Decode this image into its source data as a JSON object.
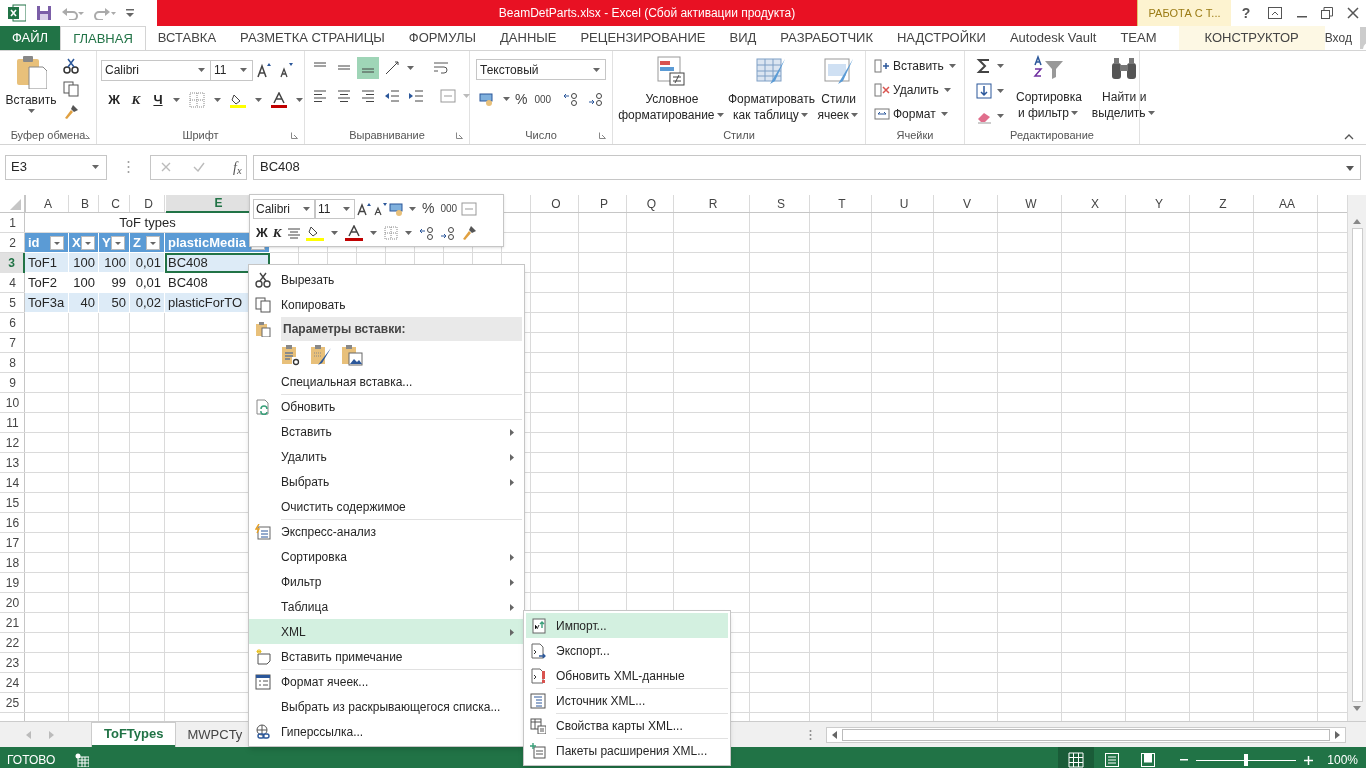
{
  "title_bar": {
    "title": "BeamDetParts.xlsx -  Excel (Сбой активации продукта)",
    "context_group": "РАБОТА С Т...",
    "help": "?"
  },
  "ribbon_tabs": [
    {
      "label": "ФАЙЛ",
      "kind": "file",
      "selected": false
    },
    {
      "label": "ГЛАВНАЯ",
      "kind": "tab",
      "selected": true
    },
    {
      "label": "ВСТАВКА",
      "kind": "tab",
      "selected": false
    },
    {
      "label": "РАЗМЕТКА СТРАНИЦЫ",
      "kind": "tab",
      "selected": false
    },
    {
      "label": "ФОРМУЛЫ",
      "kind": "tab",
      "selected": false
    },
    {
      "label": "ДАННЫЕ",
      "kind": "tab",
      "selected": false
    },
    {
      "label": "РЕЦЕНЗИРОВАНИЕ",
      "kind": "tab",
      "selected": false
    },
    {
      "label": "ВИД",
      "kind": "tab",
      "selected": false
    },
    {
      "label": "РАЗРАБОТЧИК",
      "kind": "tab",
      "selected": false
    },
    {
      "label": "НАДСТРОЙКИ",
      "kind": "tab",
      "selected": false
    },
    {
      "label": "Autodesk Vault",
      "kind": "tab",
      "selected": false
    },
    {
      "label": "TEAM",
      "kind": "tab",
      "selected": false
    },
    {
      "label": "КОНСТРУКТОР",
      "kind": "contextual",
      "selected": false
    }
  ],
  "account": {
    "label": "Вход"
  },
  "ribbon": {
    "clipboard": {
      "paste": "Вставить",
      "label": "Буфер обмена"
    },
    "font": {
      "name": "Calibri",
      "size": "11",
      "bold": "Ж",
      "italic": "К",
      "underline": "Ч",
      "label": "Шрифт"
    },
    "alignment": {
      "label": "Выравнивание",
      "vertical_align": [
        {
          "selected": false
        },
        {
          "selected": false
        },
        {
          "selected": true
        }
      ]
    },
    "number": {
      "format": "Текстовый",
      "percent": "%",
      "thousands": "000",
      "label": "Число"
    },
    "styles": {
      "buttons": [
        [
          "Условное",
          "форматирование"
        ],
        [
          "Форматировать",
          "как таблицу"
        ],
        [
          "Стили",
          "ячеек"
        ]
      ],
      "label": "Стили"
    },
    "cells": {
      "buttons": [
        "Вставить",
        "Удалить",
        "Формат"
      ],
      "label": "Ячейки"
    },
    "editing": {
      "buttons": [
        [
          "Сортировка",
          "и фильтр"
        ],
        [
          "Найти и",
          "выделить"
        ]
      ],
      "label": "Редактирование"
    }
  },
  "formula_bar": {
    "name_box": "E3",
    "fx": "f$_{x}$",
    "value": "BC408"
  },
  "sheet": {
    "columns": [
      {
        "label": "A",
        "selected": false
      },
      {
        "label": "B",
        "selected": false
      },
      {
        "label": "C",
        "selected": false
      },
      {
        "label": "D",
        "selected": false
      },
      {
        "label": "E",
        "selected": true
      },
      {
        "label": "O",
        "selected": false
      },
      {
        "label": "P",
        "selected": false
      },
      {
        "label": "Q",
        "selected": false
      },
      {
        "label": "R",
        "selected": false
      },
      {
        "label": "S",
        "selected": false
      },
      {
        "label": "T",
        "selected": false
      },
      {
        "label": "U",
        "selected": false
      },
      {
        "label": "V",
        "selected": false
      },
      {
        "label": "W",
        "selected": false
      },
      {
        "label": "X",
        "selected": false
      },
      {
        "label": "Y",
        "selected": false
      },
      {
        "label": "Z",
        "selected": false
      },
      {
        "label": "AA",
        "selected": false
      }
    ],
    "rows": [
      {
        "number": "1",
        "selected": false,
        "kind": "title",
        "cells": [
          {
            "text": "ToF types",
            "selected": false
          }
        ]
      },
      {
        "number": "2",
        "selected": false,
        "kind": "header",
        "cells": [
          {
            "text": "id",
            "selected": false
          },
          {
            "text": "X",
            "selected": false
          },
          {
            "text": "Y",
            "selected": false
          },
          {
            "text": "Z",
            "selected": false
          },
          {
            "text": "plasticMedia",
            "selected": false
          }
        ]
      },
      {
        "number": "3",
        "selected": true,
        "kind": "band",
        "cells": [
          {
            "text": "ToF1",
            "numeric": false,
            "selected": false
          },
          {
            "text": "100",
            "numeric": true,
            "selected": false
          },
          {
            "text": "100",
            "numeric": true,
            "selected": false
          },
          {
            "text": "0,01",
            "numeric": true,
            "selected": false
          },
          {
            "text": "BC408",
            "numeric": false,
            "selected": true
          }
        ]
      },
      {
        "number": "4",
        "selected": false,
        "kind": "plain",
        "cells": [
          {
            "text": "ToF2",
            "numeric": false,
            "selected": false
          },
          {
            "text": "100",
            "numeric": true,
            "selected": false
          },
          {
            "text": "99",
            "numeric": true,
            "selected": false
          },
          {
            "text": "0,01",
            "numeric": true,
            "selected": false
          },
          {
            "text": "BC408",
            "numeric": false,
            "selected": false
          }
        ]
      },
      {
        "number": "5",
        "selected": false,
        "kind": "band",
        "cells": [
          {
            "text": "ToF3a",
            "numeric": false,
            "selected": false
          },
          {
            "text": "40",
            "numeric": true,
            "selected": false
          },
          {
            "text": "50",
            "numeric": true,
            "selected": false
          },
          {
            "text": "0,02",
            "numeric": true,
            "selected": false
          },
          {
            "text": "plasticForTO",
            "numeric": false,
            "selected": false
          }
        ]
      },
      {
        "number": "6",
        "selected": false,
        "kind": "empty"
      },
      {
        "number": "7",
        "selected": false,
        "kind": "empty"
      },
      {
        "number": "8",
        "selected": false,
        "kind": "empty"
      },
      {
        "number": "9",
        "selected": false,
        "kind": "empty"
      },
      {
        "number": "10",
        "selected": false,
        "kind": "empty"
      },
      {
        "number": "11",
        "selected": false,
        "kind": "empty"
      },
      {
        "number": "12",
        "selected": false,
        "kind": "empty"
      },
      {
        "number": "13",
        "selected": false,
        "kind": "empty"
      },
      {
        "number": "14",
        "selected": false,
        "kind": "empty"
      },
      {
        "number": "15",
        "selected": false,
        "kind": "empty"
      },
      {
        "number": "16",
        "selected": false,
        "kind": "empty"
      },
      {
        "number": "17",
        "selected": false,
        "kind": "empty"
      },
      {
        "number": "18",
        "selected": false,
        "kind": "empty"
      },
      {
        "number": "19",
        "selected": false,
        "kind": "empty"
      },
      {
        "number": "20",
        "selected": false,
        "kind": "empty"
      },
      {
        "number": "21",
        "selected": false,
        "kind": "empty"
      },
      {
        "number": "22",
        "selected": false,
        "kind": "empty"
      },
      {
        "number": "23",
        "selected": false,
        "kind": "empty"
      },
      {
        "number": "24",
        "selected": false,
        "kind": "empty"
      },
      {
        "number": "25",
        "selected": false,
        "kind": "empty"
      }
    ]
  },
  "mini_toolbar": {
    "font": "Calibri",
    "size": "11",
    "percent": "%",
    "thousands": "000",
    "bold": "Ж",
    "italic": "К"
  },
  "context_menu": {
    "items": [
      {
        "kind": "item",
        "label": "Вырезать",
        "submenu": false,
        "selected": false,
        "separator_before": false
      },
      {
        "kind": "item",
        "label": "Копировать",
        "submenu": false,
        "selected": false,
        "separator_before": false
      },
      {
        "kind": "header",
        "label": "Параметры вставки:"
      },
      {
        "kind": "paste_options"
      },
      {
        "kind": "item",
        "label": "Специальная вставка...",
        "submenu": false,
        "selected": false,
        "separator_before": false
      },
      {
        "kind": "item",
        "label": "Обновить",
        "submenu": false,
        "selected": false,
        "separator_before": true
      },
      {
        "kind": "item",
        "label": "Вставить",
        "submenu": true,
        "selected": false,
        "separator_before": true
      },
      {
        "kind": "item",
        "label": "Удалить",
        "submenu": true,
        "selected": false,
        "separator_before": false
      },
      {
        "kind": "item",
        "label": "Выбрать",
        "submenu": true,
        "selected": false,
        "separator_before": false
      },
      {
        "kind": "item",
        "label": "Очистить содержимое",
        "submenu": false,
        "selected": false,
        "separator_before": false
      },
      {
        "kind": "item",
        "label": "Экспресс-анализ",
        "submenu": false,
        "selected": false,
        "separator_before": true
      },
      {
        "kind": "item",
        "label": "Сортировка",
        "submenu": true,
        "selected": false,
        "separator_before": false
      },
      {
        "kind": "item",
        "label": "Фильтр",
        "submenu": true,
        "selected": false,
        "separator_before": false
      },
      {
        "kind": "item",
        "label": "Таблица",
        "submenu": true,
        "selected": false,
        "separator_before": false
      },
      {
        "kind": "item",
        "label": "XML",
        "submenu": true,
        "selected": true,
        "separator_before": false
      },
      {
        "kind": "item",
        "label": "Вставить примечание",
        "submenu": false,
        "selected": false,
        "separator_before": false
      },
      {
        "kind": "item",
        "label": "Формат ячеек...",
        "submenu": false,
        "selected": false,
        "separator_before": true
      },
      {
        "kind": "item",
        "label": "Выбрать из раскрывающегося списка...",
        "submenu": false,
        "selected": false,
        "separator_before": false
      },
      {
        "kind": "item",
        "label": "Гиперссылка...",
        "submenu": false,
        "selected": false,
        "separator_before": false
      }
    ]
  },
  "xml_submenu": {
    "items": [
      {
        "label": "Импорт...",
        "selected": true,
        "separator_before": false
      },
      {
        "label": "Экспорт...",
        "selected": false,
        "separator_before": false
      },
      {
        "label": "Обновить XML-данные",
        "selected": false,
        "separator_before": false
      },
      {
        "label": "Источник XML...",
        "selected": false,
        "separator_before": true
      },
      {
        "label": "Свойства карты XML...",
        "selected": false,
        "separator_before": true
      },
      {
        "label": "Пакеты расширения XML...",
        "selected": false,
        "separator_before": true
      }
    ]
  },
  "sheet_tabs": [
    {
      "label": "ToFTypes",
      "selected": true
    },
    {
      "label": "MWPCTy",
      "selected": false
    }
  ],
  "status_bar": {
    "status": "ГОТОВО",
    "views": [
      {
        "selected": true
      },
      {
        "selected": false
      },
      {
        "selected": false
      }
    ],
    "zoom_slider": {
      "level": 0.5
    },
    "zoom": "100%"
  }
}
